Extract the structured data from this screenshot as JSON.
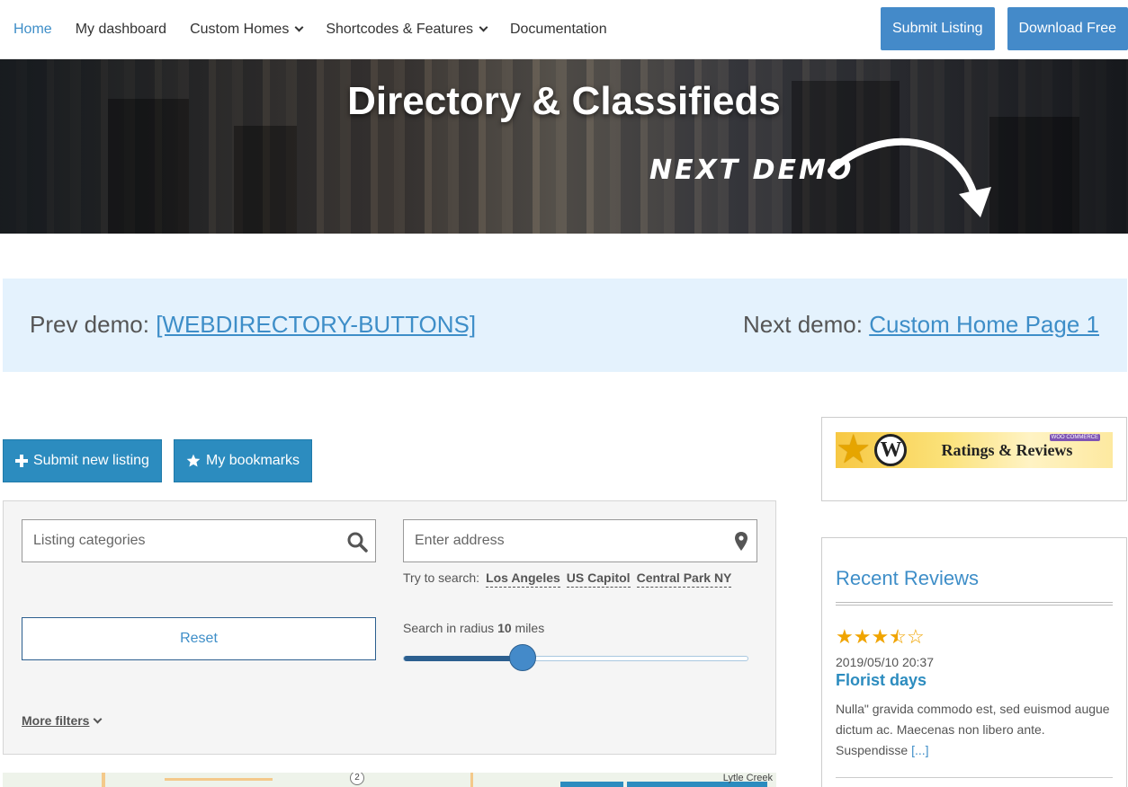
{
  "nav": {
    "items": [
      {
        "label": "Home",
        "active": true,
        "dropdown": false
      },
      {
        "label": "My dashboard",
        "active": false,
        "dropdown": false
      },
      {
        "label": "Custom Homes",
        "active": false,
        "dropdown": true
      },
      {
        "label": "Shortcodes & Features",
        "active": false,
        "dropdown": true
      },
      {
        "label": "Documentation",
        "active": false,
        "dropdown": false
      }
    ],
    "submit_listing": "Submit Listing",
    "download_free": "Download Free"
  },
  "hero": {
    "title": "Directory & Classifieds",
    "next_demo": "NEXT DEMO"
  },
  "demo_bar": {
    "prev_label": "Prev demo:",
    "prev_link": "[WEBDIRECTORY-BUTTONS]",
    "next_label": "Next demo:",
    "next_link": "Custom Home Page 1"
  },
  "actions": {
    "submit_new_listing": "Submit new listing",
    "my_bookmarks": "My bookmarks"
  },
  "search": {
    "categories_placeholder": "Listing categories",
    "address_placeholder": "Enter address",
    "try_label": "Try to search:",
    "try_tags": [
      "Los Angeles",
      "US Capitol",
      "Central Park NY"
    ],
    "reset": "Reset",
    "radius_prefix": "Search in radius",
    "radius_value": "10",
    "radius_unit": "miles",
    "radius_fraction": 0.345,
    "more_filters": "More filters"
  },
  "map": {
    "place_label": "Lytle Creek",
    "route_number": "2"
  },
  "sidebar": {
    "banner_text": "Ratings & Reviews",
    "banner_badge": "WOO COMMERCE",
    "recent_reviews": {
      "heading": "Recent Reviews",
      "rating": 3.5,
      "date": "2019/05/10 20:37",
      "title": "Florist days",
      "text": "Nulla\" gravida commodo est, sed euismod augue dictum ac. Maecenas non libero ante. Suspendisse",
      "more": "[...]"
    }
  },
  "colors": {
    "accent": "#3e8ec8",
    "button_blue": "#448ac9",
    "teal": "#2c8cbf",
    "demo_bar_bg": "#e4f2fd",
    "star": "#f0a400"
  }
}
